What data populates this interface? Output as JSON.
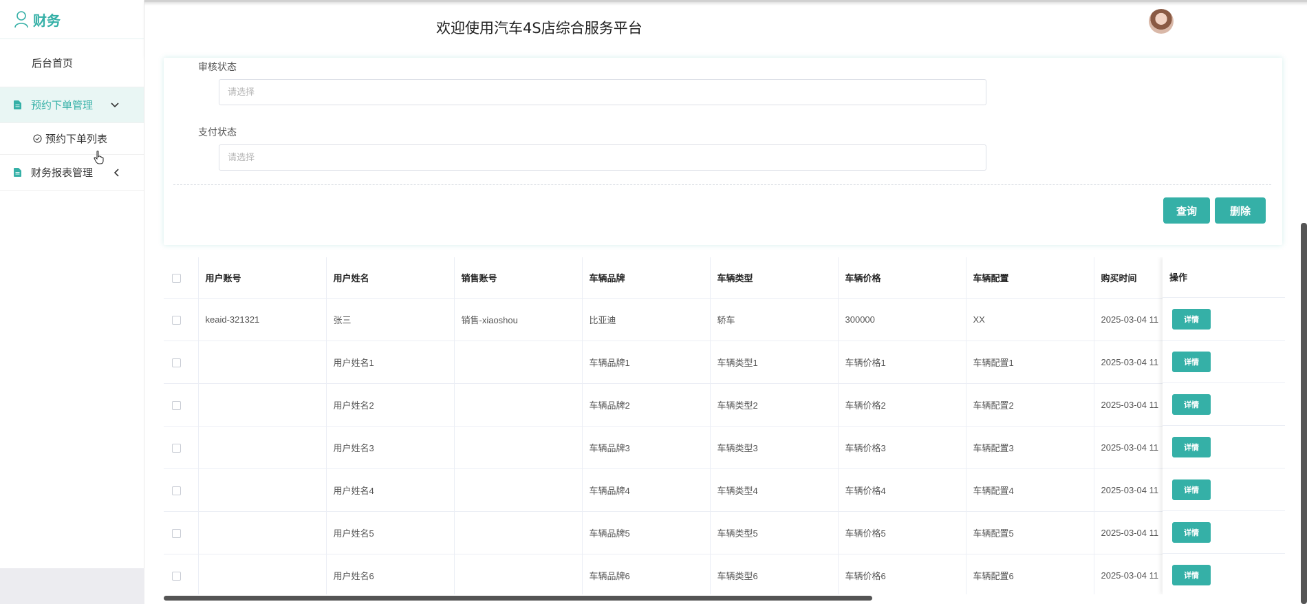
{
  "sidebar": {
    "brand": "财务",
    "home": "后台首页",
    "menu_order": "预约下单管理",
    "submenu_order_list": "预约下单列表",
    "menu_report": "财务报表管理"
  },
  "header": {
    "title": "欢迎使用汽车4S店综合服务平台"
  },
  "search": {
    "audit_label": "审核状态",
    "audit_placeholder": "请选择",
    "pay_label": "支付状态",
    "pay_placeholder": "请选择",
    "query_label": "查询",
    "delete_label": "删除"
  },
  "table": {
    "columns": [
      "用户账号",
      "用户姓名",
      "销售账号",
      "车辆品牌",
      "车辆类型",
      "车辆价格",
      "车辆配置",
      "购买时间"
    ],
    "op_column": "操作",
    "detail_label": "详情",
    "rows": [
      [
        "keaid-321321",
        "张三",
        "销售-xiaoshou",
        "比亚迪",
        "轿车",
        "300000",
        "XX",
        "2025-03-04 11"
      ],
      [
        "",
        "用户姓名1",
        "",
        "车辆品牌1",
        "车辆类型1",
        "车辆价格1",
        "车辆配置1",
        "2025-03-04 11"
      ],
      [
        "",
        "用户姓名2",
        "",
        "车辆品牌2",
        "车辆类型2",
        "车辆价格2",
        "车辆配置2",
        "2025-03-04 11"
      ],
      [
        "",
        "用户姓名3",
        "",
        "车辆品牌3",
        "车辆类型3",
        "车辆价格3",
        "车辆配置3",
        "2025-03-04 11"
      ],
      [
        "",
        "用户姓名4",
        "",
        "车辆品牌4",
        "车辆类型4",
        "车辆价格4",
        "车辆配置4",
        "2025-03-04 11"
      ],
      [
        "",
        "用户姓名5",
        "",
        "车辆品牌5",
        "车辆类型5",
        "车辆价格5",
        "车辆配置5",
        "2025-03-04 11"
      ],
      [
        "",
        "用户姓名6",
        "",
        "车辆品牌6",
        "车辆类型6",
        "车辆价格6",
        "车辆配置6",
        "2025-03-04 11"
      ]
    ]
  },
  "colors": {
    "accent": "#35b0a7"
  }
}
